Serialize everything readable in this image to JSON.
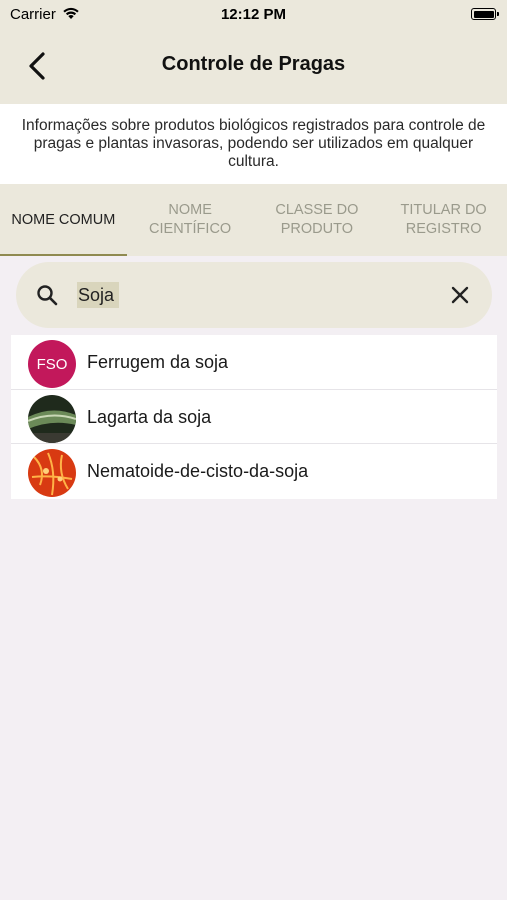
{
  "status_bar": {
    "carrier": "Carrier",
    "time": "12:12 PM"
  },
  "nav": {
    "title": "Controle de Pragas",
    "back_icon": "chevron-left-icon"
  },
  "info_text": "Informações sobre produtos biológicos registrados para controle de pragas e plantas invasoras, podendo ser utilizados em qualquer cultura.",
  "tabs": [
    {
      "label": "NOME COMUM",
      "active": true
    },
    {
      "label": "NOME CIENTÍFICO",
      "active": false
    },
    {
      "label": "CLASSE DO PRODUTO",
      "active": false
    },
    {
      "label": "TITULAR DO REGISTRO",
      "active": false
    }
  ],
  "search": {
    "value": "Soja",
    "search_icon": "search-icon",
    "clear_icon": "close-icon"
  },
  "results": [
    {
      "label": "Ferrugem da soja",
      "avatar_text": "FSO",
      "avatar_color": "#c2185b"
    },
    {
      "label": "Lagarta da soja",
      "avatar_text": "",
      "avatar_color": "#3a4a30"
    },
    {
      "label": "Nematoide-de-cisto-da-soja",
      "avatar_text": "",
      "avatar_color": "#d83a12"
    }
  ],
  "colors": {
    "header_bg": "#ebe8dc",
    "accent": "#8f8a50",
    "background": "#f3eff3"
  }
}
